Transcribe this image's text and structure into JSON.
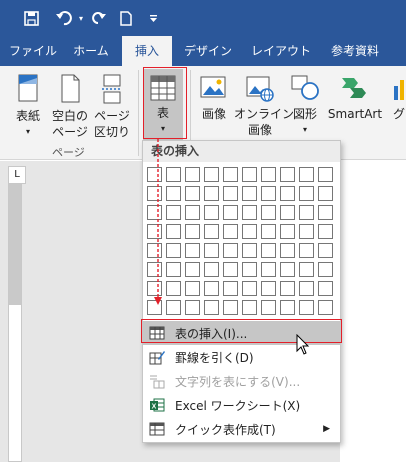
{
  "quick_access": {
    "save_icon": "save-icon",
    "undo_icon": "undo-icon",
    "redo_icon": "redo-icon",
    "new_doc_icon": "new-document-icon",
    "customize_icon": "customize-qat-icon"
  },
  "tabs": [
    {
      "label": "ファイル"
    },
    {
      "label": "ホーム"
    },
    {
      "label": "挿入"
    },
    {
      "label": "デザイン"
    },
    {
      "label": "レイアウト"
    },
    {
      "label": "参考資料"
    }
  ],
  "ribbon": {
    "cover_page": "表紙",
    "blank_page_line1": "空白の",
    "blank_page_line2": "ページ",
    "page_break_line1": "ページ",
    "page_break_line2": "区切り",
    "pages_group_label": "ページ",
    "table": "表",
    "pictures": "画像",
    "online_pictures_line1": "オンライン",
    "online_pictures_line2": "画像",
    "shapes": "図形",
    "smartart": "SmartArt",
    "chart_partial": "グ"
  },
  "dropdown": {
    "header": "表の挿入",
    "grid_cols": 10,
    "grid_rows": 8,
    "items": [
      {
        "label": "表の挿入(I)...",
        "icon": "insert-table-icon",
        "state": "highlighted"
      },
      {
        "label": "罫線を引く(D)",
        "icon": "draw-table-icon",
        "state": "normal"
      },
      {
        "label": "文字列を表にする(V)...",
        "icon": "text-to-table-icon",
        "state": "disabled"
      },
      {
        "label": "Excel ワークシート(X)",
        "icon": "excel-sheet-icon",
        "state": "normal"
      },
      {
        "label": "クイック表作成(T)",
        "icon": "quick-tables-icon",
        "state": "normal",
        "submenu": true
      }
    ]
  },
  "ruler": {
    "tab_selector": "L"
  },
  "colors": {
    "brand": "#2b579a",
    "annotation": "#e3202a",
    "highlight": "#c6c6c6"
  }
}
